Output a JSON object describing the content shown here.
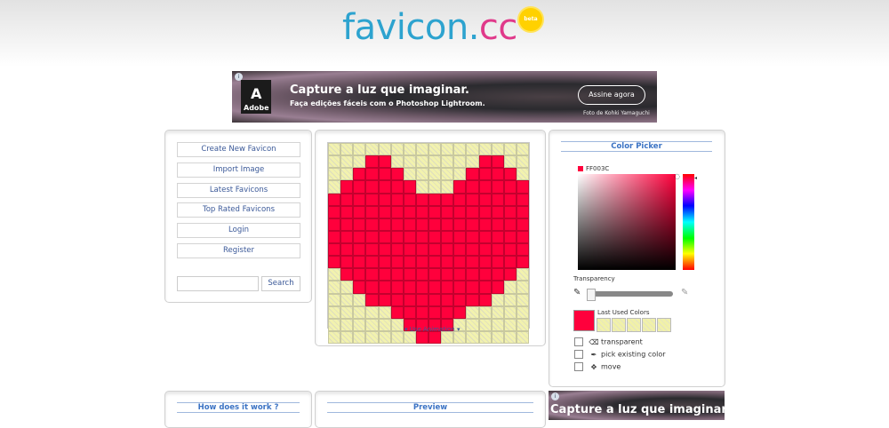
{
  "logo": {
    "part1": "favicon.",
    "part2": "cc",
    "badge": "beta"
  },
  "ad_top": {
    "brand": "Adobe",
    "headline": "Capture a luz que imaginar.",
    "subline": "Faça edições fáceis com o Photoshop Lightroom.",
    "button": "Assine agora",
    "credit": "Foto de Kohki Yamaguchi"
  },
  "ad_bottom": {
    "headline": "Capture a luz que imaginar."
  },
  "menu": {
    "items": [
      {
        "label": "Create New Favicon"
      },
      {
        "label": "Import Image"
      },
      {
        "label": "Latest Favicons"
      },
      {
        "label": "Top Rated Favicons"
      },
      {
        "label": "Login"
      },
      {
        "label": "Register"
      }
    ],
    "search_button": "Search",
    "search_value": ""
  },
  "editor": {
    "grid_size": 16,
    "pixel_color": "#ff003c",
    "empty_pattern": "transparent-checker",
    "rows": [
      "................",
      "...##.......##..",
      "..####.....####.",
      ".######...######",
      "################",
      "################",
      "################",
      "################",
      "################",
      "################",
      ".##############.",
      "..############..",
      "...##########...",
      ".....######.....",
      "......####......",
      ".......##......."
    ],
    "animation_link": "▾ Use Animation ▾"
  },
  "color_picker": {
    "title": "Color Picker",
    "current_hex": "FF003C",
    "current_color": "#ff003c",
    "transparency_label": "Transparency",
    "transparency_value": 0,
    "last_used_label": "Last Used Colors",
    "last_used": [
      "#ff003c",
      "transparent",
      "transparent",
      "transparent",
      "transparent",
      "transparent"
    ],
    "options": [
      {
        "label": "transparent",
        "icon": "eraser-icon",
        "checked": false
      },
      {
        "label": "pick existing color",
        "icon": "eyedropper-icon",
        "checked": false
      },
      {
        "label": "move",
        "icon": "move-arrows-icon",
        "checked": false
      }
    ]
  },
  "bottom": {
    "how_title": "How does it work ?",
    "preview_title": "Preview"
  }
}
